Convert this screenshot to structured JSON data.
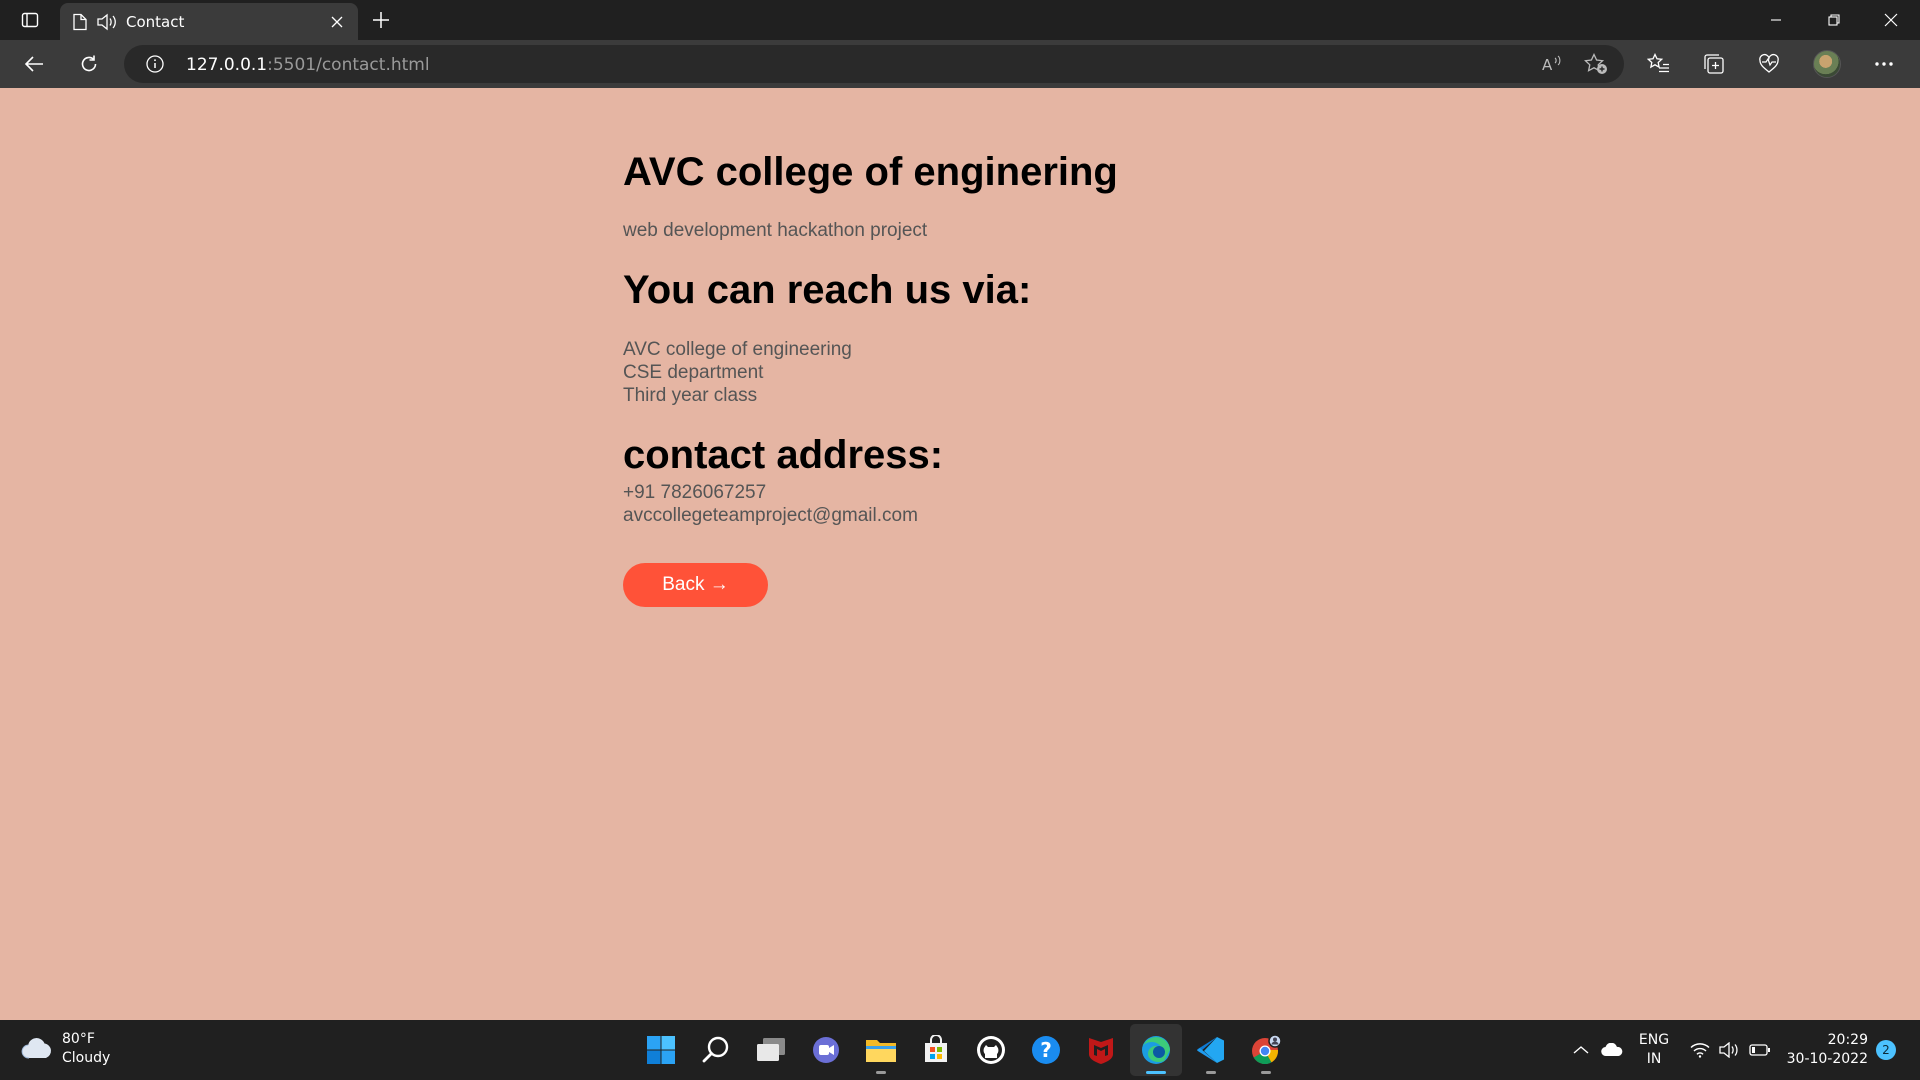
{
  "browser": {
    "tab": {
      "title": "Contact"
    },
    "address": {
      "host": "127.0.0.1",
      "path": ":5501/contact.html"
    }
  },
  "page": {
    "title": "AVC college of enginering",
    "subtitle": "web development hackathon project",
    "reach_heading": "You can reach us via:",
    "address_lines": [
      "AVC college of engineering",
      "CSE department",
      "Third year class"
    ],
    "contact_heading": "contact address:",
    "phone": "+91 7826067257",
    "email": "avccollegeteamproject@gmail.com",
    "back_label": "Back →",
    "background_color": "#e5b5a3",
    "button_color": "#ff5238"
  },
  "taskbar": {
    "weather": {
      "temp": "80°F",
      "condition": "Cloudy"
    },
    "apps": [
      "start-icon",
      "search-icon",
      "task-view-icon",
      "chat-icon",
      "file-explorer-icon",
      "store-icon",
      "github-icon",
      "help-icon",
      "mcafee-icon",
      "edge-icon",
      "vscode-icon",
      "chrome-icon"
    ],
    "language": {
      "line1": "ENG",
      "line2": "IN"
    },
    "clock": {
      "time": "20:29",
      "date": "30-10-2022"
    },
    "notification_count": "2"
  }
}
